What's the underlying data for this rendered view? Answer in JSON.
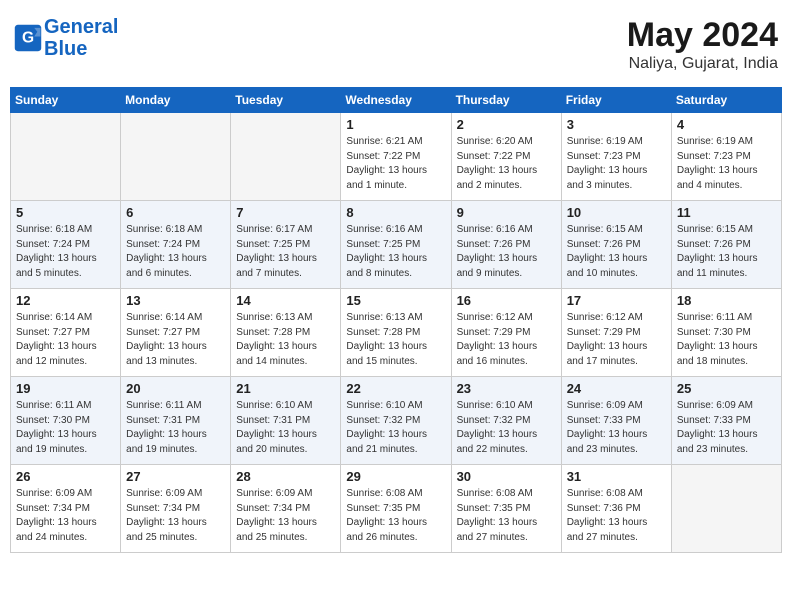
{
  "header": {
    "logo_line1": "General",
    "logo_line2": "Blue",
    "title": "May 2024",
    "location": "Naliya, Gujarat, India"
  },
  "weekdays": [
    "Sunday",
    "Monday",
    "Tuesday",
    "Wednesday",
    "Thursday",
    "Friday",
    "Saturday"
  ],
  "weeks": [
    [
      {
        "num": "",
        "info": ""
      },
      {
        "num": "",
        "info": ""
      },
      {
        "num": "",
        "info": ""
      },
      {
        "num": "1",
        "info": "Sunrise: 6:21 AM\nSunset: 7:22 PM\nDaylight: 13 hours\nand 1 minute."
      },
      {
        "num": "2",
        "info": "Sunrise: 6:20 AM\nSunset: 7:22 PM\nDaylight: 13 hours\nand 2 minutes."
      },
      {
        "num": "3",
        "info": "Sunrise: 6:19 AM\nSunset: 7:23 PM\nDaylight: 13 hours\nand 3 minutes."
      },
      {
        "num": "4",
        "info": "Sunrise: 6:19 AM\nSunset: 7:23 PM\nDaylight: 13 hours\nand 4 minutes."
      }
    ],
    [
      {
        "num": "5",
        "info": "Sunrise: 6:18 AM\nSunset: 7:24 PM\nDaylight: 13 hours\nand 5 minutes."
      },
      {
        "num": "6",
        "info": "Sunrise: 6:18 AM\nSunset: 7:24 PM\nDaylight: 13 hours\nand 6 minutes."
      },
      {
        "num": "7",
        "info": "Sunrise: 6:17 AM\nSunset: 7:25 PM\nDaylight: 13 hours\nand 7 minutes."
      },
      {
        "num": "8",
        "info": "Sunrise: 6:16 AM\nSunset: 7:25 PM\nDaylight: 13 hours\nand 8 minutes."
      },
      {
        "num": "9",
        "info": "Sunrise: 6:16 AM\nSunset: 7:26 PM\nDaylight: 13 hours\nand 9 minutes."
      },
      {
        "num": "10",
        "info": "Sunrise: 6:15 AM\nSunset: 7:26 PM\nDaylight: 13 hours\nand 10 minutes."
      },
      {
        "num": "11",
        "info": "Sunrise: 6:15 AM\nSunset: 7:26 PM\nDaylight: 13 hours\nand 11 minutes."
      }
    ],
    [
      {
        "num": "12",
        "info": "Sunrise: 6:14 AM\nSunset: 7:27 PM\nDaylight: 13 hours\nand 12 minutes."
      },
      {
        "num": "13",
        "info": "Sunrise: 6:14 AM\nSunset: 7:27 PM\nDaylight: 13 hours\nand 13 minutes."
      },
      {
        "num": "14",
        "info": "Sunrise: 6:13 AM\nSunset: 7:28 PM\nDaylight: 13 hours\nand 14 minutes."
      },
      {
        "num": "15",
        "info": "Sunrise: 6:13 AM\nSunset: 7:28 PM\nDaylight: 13 hours\nand 15 minutes."
      },
      {
        "num": "16",
        "info": "Sunrise: 6:12 AM\nSunset: 7:29 PM\nDaylight: 13 hours\nand 16 minutes."
      },
      {
        "num": "17",
        "info": "Sunrise: 6:12 AM\nSunset: 7:29 PM\nDaylight: 13 hours\nand 17 minutes."
      },
      {
        "num": "18",
        "info": "Sunrise: 6:11 AM\nSunset: 7:30 PM\nDaylight: 13 hours\nand 18 minutes."
      }
    ],
    [
      {
        "num": "19",
        "info": "Sunrise: 6:11 AM\nSunset: 7:30 PM\nDaylight: 13 hours\nand 19 minutes."
      },
      {
        "num": "20",
        "info": "Sunrise: 6:11 AM\nSunset: 7:31 PM\nDaylight: 13 hours\nand 19 minutes."
      },
      {
        "num": "21",
        "info": "Sunrise: 6:10 AM\nSunset: 7:31 PM\nDaylight: 13 hours\nand 20 minutes."
      },
      {
        "num": "22",
        "info": "Sunrise: 6:10 AM\nSunset: 7:32 PM\nDaylight: 13 hours\nand 21 minutes."
      },
      {
        "num": "23",
        "info": "Sunrise: 6:10 AM\nSunset: 7:32 PM\nDaylight: 13 hours\nand 22 minutes."
      },
      {
        "num": "24",
        "info": "Sunrise: 6:09 AM\nSunset: 7:33 PM\nDaylight: 13 hours\nand 23 minutes."
      },
      {
        "num": "25",
        "info": "Sunrise: 6:09 AM\nSunset: 7:33 PM\nDaylight: 13 hours\nand 23 minutes."
      }
    ],
    [
      {
        "num": "26",
        "info": "Sunrise: 6:09 AM\nSunset: 7:34 PM\nDaylight: 13 hours\nand 24 minutes."
      },
      {
        "num": "27",
        "info": "Sunrise: 6:09 AM\nSunset: 7:34 PM\nDaylight: 13 hours\nand 25 minutes."
      },
      {
        "num": "28",
        "info": "Sunrise: 6:09 AM\nSunset: 7:34 PM\nDaylight: 13 hours\nand 25 minutes."
      },
      {
        "num": "29",
        "info": "Sunrise: 6:08 AM\nSunset: 7:35 PM\nDaylight: 13 hours\nand 26 minutes."
      },
      {
        "num": "30",
        "info": "Sunrise: 6:08 AM\nSunset: 7:35 PM\nDaylight: 13 hours\nand 27 minutes."
      },
      {
        "num": "31",
        "info": "Sunrise: 6:08 AM\nSunset: 7:36 PM\nDaylight: 13 hours\nand 27 minutes."
      },
      {
        "num": "",
        "info": ""
      }
    ]
  ]
}
